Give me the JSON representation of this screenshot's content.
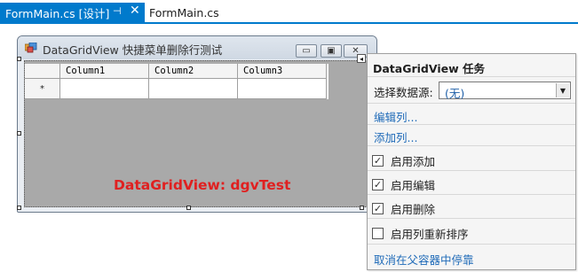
{
  "tabs": {
    "active": {
      "title": "FormMain.cs [设计]",
      "pin_glyph": "⊣",
      "close_glyph": "✕"
    },
    "inactive": {
      "title": "FormMain.cs"
    }
  },
  "form": {
    "title": "DataGridView 快捷菜单删除行测试",
    "controls": {
      "minimize": "▭",
      "maximize": "▣",
      "close": "✕"
    },
    "grid": {
      "columns": [
        "Column1",
        "Column2",
        "Column3"
      ],
      "new_row_marker": "*"
    },
    "caption": "DataGridView: dgvTest"
  },
  "tasks_panel": {
    "title": "DataGridView 任务",
    "datasource_label": "选择数据源:",
    "datasource_value": "(无)",
    "dropdown_glyph": "▼",
    "edit_columns": "编辑列...",
    "add_column": "添加列...",
    "enable_adding": {
      "label": "启用添加",
      "checked": true
    },
    "enable_editing": {
      "label": "启用编辑",
      "checked": true
    },
    "enable_deleting": {
      "label": "启用删除",
      "checked": true
    },
    "enable_reorder": {
      "label": "启用列重新排序",
      "checked": false
    },
    "undock": "取消在父容器中停靠",
    "check_glyph": "✓"
  },
  "colors": {
    "accent": "#007acc",
    "caption": "#e02020",
    "link": "#1e6ab8"
  }
}
